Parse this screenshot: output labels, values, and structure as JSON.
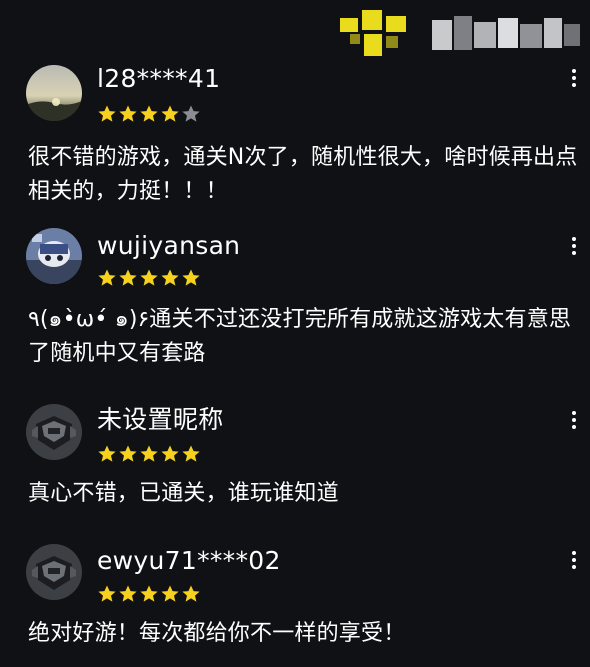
{
  "colors": {
    "background": "#101114",
    "text": "#ffffff",
    "star_filled": "#f6d21e",
    "star_empty": "#8a8d93"
  },
  "icons": {
    "menu": "more-vertical-icon",
    "star": "star-icon"
  },
  "reviews": [
    {
      "username": "l28****41",
      "rating": 4,
      "max_rating": 5,
      "avatar": "sunset-landscape-avatar",
      "text": "很不错的游戏，通关N次了，随机性很大，啥时候再出点相关的，力挺！！！"
    },
    {
      "username": "wujiyansan",
      "rating": 5,
      "max_rating": 5,
      "avatar": "cartoon-photo-avatar",
      "text": "٩(๑•̀ω•́ ๑)۶通关不过还没打完所有成就这游戏太有意思了随机中又有套路"
    },
    {
      "username": "未设置昵称",
      "rating": 5,
      "max_rating": 5,
      "avatar": "default-helmet-avatar",
      "text": "真心不错，已通关，谁玩谁知道"
    },
    {
      "username": "ewyu71****02",
      "rating": 5,
      "max_rating": 5,
      "avatar": "default-helmet-avatar",
      "text": "绝对好游！每次都给你不一样的享受！"
    }
  ]
}
